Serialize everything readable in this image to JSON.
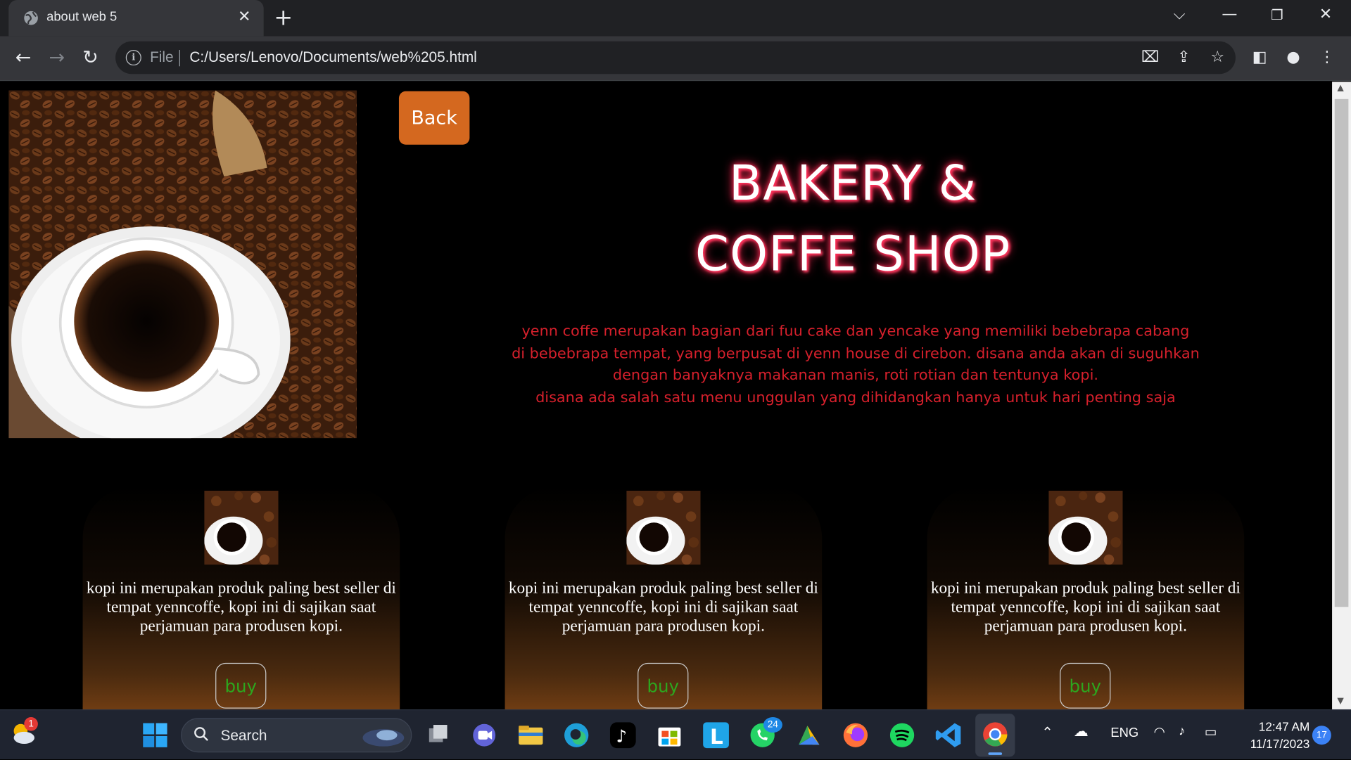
{
  "browser": {
    "tab_title": "about web 5",
    "address_scheme": "File",
    "address_url": "C:/Users/Lenovo/Documents/web%205.html"
  },
  "page": {
    "back_label": "Back",
    "headline_line1": "BAKERY &",
    "headline_line2": "COFFE SHOP",
    "description": [
      "yenn coffe merupakan bagian dari fuu cake dan yencake yang memiliki bebebrapa cabang",
      "di bebebrapa tempat, yang berpusat di yenn house di cirebon. disana anda akan di suguhkan",
      "dengan banyaknya makanan manis, roti rotian dan tentunya kopi.",
      "disana ada salah satu menu unggulan yang dihidangkan hanya untuk hari penting saja"
    ],
    "cards": [
      {
        "text": "kopi ini merupakan produk paling best seller di tempat yenncoffe, kopi ini di sajikan saat perjamuan para produsen kopi.",
        "buy_label": "buy"
      },
      {
        "text": "kopi ini merupakan produk paling best seller di tempat yenncoffe, kopi ini di sajikan saat perjamuan para produsen kopi.",
        "buy_label": "buy"
      },
      {
        "text": "kopi ini merupakan produk paling best seller di tempat yenncoffe, kopi ini di sajikan saat perjamuan para produsen kopi.",
        "buy_label": "buy"
      }
    ]
  },
  "taskbar": {
    "search_label": "Search",
    "whatsapp_badge": "24",
    "weather_badge": "1",
    "language": "ENG",
    "time": "12:47 AM",
    "date": "11/17/2023",
    "notification_count": "17"
  },
  "colors": {
    "back_button": "#d4681f",
    "headline_glow": "#ff2a55",
    "description_text": "#d6202c",
    "buy_text": "#2da61e"
  }
}
